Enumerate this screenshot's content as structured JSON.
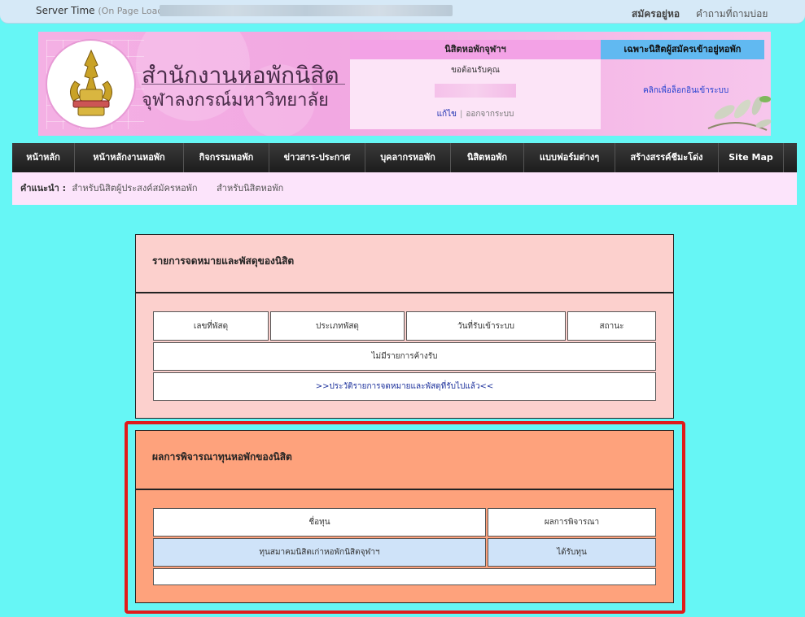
{
  "topbar": {
    "server_time_label": "Server Time",
    "on_page_load": "(On Page Load):",
    "apply_link": "สมัครอยู่หอ",
    "faq_link": "คำถามที่ถามบ่อย"
  },
  "banner": {
    "org_line1": "สำนักงานหอพักนิสิต",
    "org_line2": "จุฬาลงกรณ์มหาวิทยาลัย"
  },
  "login_panel": {
    "title": "นิสิตหอพักจุฬาฯ",
    "welcome": "ขอต้อนรับคุณ",
    "edit_link": "แก้ไข",
    "separator": "|",
    "logout_link": "ออกจากระบบ"
  },
  "resident_panel": {
    "title": "เฉพาะนิสิตผู้สมัครเข้าอยู่หอพัก",
    "login_link": "คลิกเพื่อล็อกอินเข้าระบบ"
  },
  "nav": {
    "items": [
      {
        "label": "หน้าหลัก",
        "w": 77
      },
      {
        "label": "หน้าหลักงานหอพัก",
        "w": 134
      },
      {
        "label": "กิจกรรมหอพัก",
        "w": 105
      },
      {
        "label": "ข่าวสาร-ประกาศ",
        "w": 118
      },
      {
        "label": "บุคลากรหอพัก",
        "w": 105
      },
      {
        "label": "นิสิตหอพัก",
        "w": 90
      },
      {
        "label": "แบบฟอร์มต่างๆ",
        "w": 112
      },
      {
        "label": "สร้างสรรค์ชีมะโด่ง",
        "w": 127
      },
      {
        "label": "Site Map",
        "w": 80
      }
    ]
  },
  "subnav": {
    "label": "คำแนะนำ :",
    "item1": "สำหรับนิสิตผู้ประสงค์สมัครหอพัก",
    "item2": "สำหรับนิสิตหอพัก"
  },
  "mail": {
    "title": "รายการจดหมายและพัสดุของนิสิต",
    "headers": [
      "เลขที่พัสดุ",
      "ประเภทพัสดุ",
      "วันที่รับเข้าระบบ",
      "สถานะ"
    ],
    "empty_message": "ไม่มีรายการค้างรับ",
    "history_link": ">>ประวัติรายการจดหมายและพัสดุที่รับไปแล้ว<<"
  },
  "scholarship": {
    "title": "ผลการพิจารณาทุนหอพักของนิสิต",
    "headers": [
      "ชื่อทุน",
      "ผลการพิจารณา"
    ],
    "rows": [
      {
        "name": "ทุนสมาคมนิสิตเก่าหอพักนิสิตจุฬาฯ",
        "result": "ได้รับทุน"
      }
    ]
  },
  "colors": {
    "page_bg": "#66f6f5",
    "mail_bg": "#fcd0cd",
    "scholarship_bg": "#fea27c",
    "highlight_frame": "#e01a1a",
    "row_highlight": "#cfe3f9"
  }
}
